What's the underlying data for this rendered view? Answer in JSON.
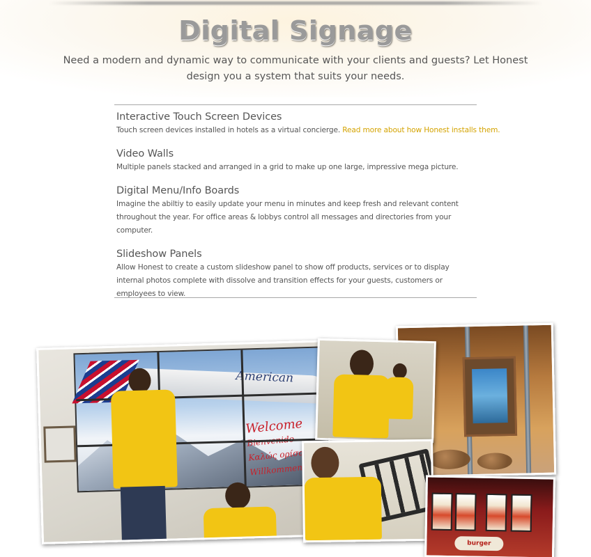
{
  "header": {
    "title": "Digital Signage",
    "intro": "Need a modern and dynamic way to communicate with your clients and guests? Let Honest design you a system that suits your needs."
  },
  "services": [
    {
      "title": "Interactive Touch Screen Devices",
      "description": "Touch screen devices installed in hotels as a virtual concierge. ",
      "link": "Read more about how Honest installs them."
    },
    {
      "title": "Video Walls",
      "description": "Multiple panels stacked and arranged in a grid to make up one large, impressive mega picture."
    },
    {
      "title": "Digital Menu/Info Boards",
      "description": "Imagine the abiltiy to easily update your menu in minutes and keep fresh and relevant content throughout the year. For office areas & lobbys control all messages and directories from your computer."
    },
    {
      "title": "Slideshow Panels",
      "description": "Allow Honest to create a custom slideshow panel to show off products, services or to display internal photos complete with dissolve and transition effects for your guests, customers or employees to view."
    }
  ],
  "colors": {
    "link": "#d4a300",
    "title": "#9a9a9a",
    "body_text": "#555555",
    "uniform_yellow": "#f2c514"
  },
  "collage": {
    "wall_screen_brand": "American",
    "wall_screen_welcome": [
      "Welcome",
      "Bienvenido",
      "Καλώς ορίσατε",
      "Willkommen"
    ],
    "menu_sign": "burger"
  }
}
